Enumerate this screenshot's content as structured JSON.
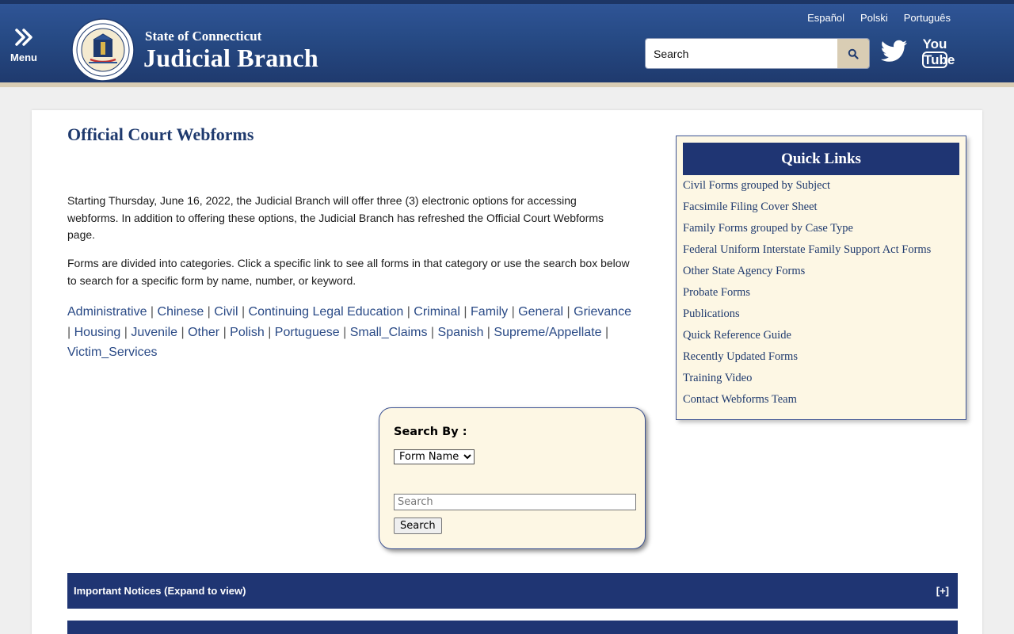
{
  "header": {
    "menu_label": "Menu",
    "brand_top": "State of Connecticut",
    "brand_main": "Judicial Branch",
    "seal_text_top": "STATE OF CONNECTICUT",
    "seal_text_bottom": "JUDICIAL BRANCH",
    "languages": [
      "Español",
      "Polski",
      "Português"
    ],
    "search_placeholder": "Search",
    "youtube_top": "You",
    "youtube_bottom": "Tube",
    "colors": {
      "bar": "#274b86",
      "accent": "#d9cdb4"
    }
  },
  "main": {
    "title": "Official Court Webforms",
    "para1": "Starting Thursday, June 16, 2022, the Judicial Branch will offer three (3) electronic options for accessing webforms. In addition to offering these options, the Judicial Branch has refreshed the Official Court Webforms page.",
    "para2": "Forms are divided into categories. Click a specific link to see all forms in that category or use the search box below to search for a specific form by name, number, or keyword.",
    "categories": [
      "Administrative",
      "Chinese",
      "Civil",
      "Continuing Legal Education",
      "Criminal",
      "Family",
      "General",
      "Grievance",
      "Housing",
      "Juvenile",
      "Other",
      "Polish",
      "Portuguese",
      "Small_Claims",
      "Spanish",
      "Supreme/Appellate",
      "Victim_Services"
    ]
  },
  "quick_links": {
    "title": "Quick Links",
    "items": [
      "Civil Forms grouped by Subject",
      "Facsimile Filing Cover Sheet",
      "Family Forms grouped by Case Type",
      "Federal Uniform Interstate Family Support Act Forms",
      "Other State Agency Forms",
      "Probate Forms",
      "Publications",
      "Quick Reference Guide",
      "Recently Updated Forms",
      "Training Video",
      "Contact Webforms Team"
    ]
  },
  "search_panel": {
    "label": "Search By :",
    "selected_option": "Form Name",
    "input_placeholder": "Search",
    "button_label": "Search"
  },
  "notices": {
    "title": "Important Notices (Expand to view)",
    "toggle": "[+]"
  }
}
